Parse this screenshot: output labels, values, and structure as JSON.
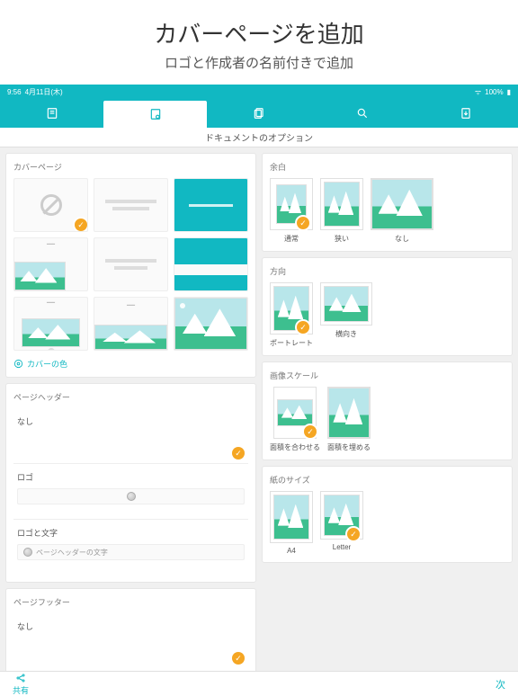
{
  "promo": {
    "title": "カバーページを追加",
    "subtitle": "ロゴと作成者の名前付きで追加"
  },
  "status": {
    "time": "9:56",
    "date": "4月11日(木)",
    "battery": "100%"
  },
  "subbar": {
    "title": "ドキュメントのオプション"
  },
  "cover": {
    "title": "カバーページ",
    "color_link": "カバーの色"
  },
  "header": {
    "title": "ページヘッダー",
    "none": "なし",
    "logo": "ロゴ",
    "logo_text": "ロゴと文字",
    "placeholder": "ページヘッダーの文字"
  },
  "footer": {
    "title": "ページフッター",
    "none": "なし"
  },
  "margin": {
    "title": "余白",
    "normal": "通常",
    "narrow": "狭い",
    "none": "なし"
  },
  "orient": {
    "title": "方向",
    "portrait": "ポートレート",
    "landscape": "横向き"
  },
  "scale": {
    "title": "画像スケール",
    "fit": "面積を合わせる",
    "fill": "面積を埋める"
  },
  "paper": {
    "title": "紙のサイズ",
    "a4": "A4",
    "letter": "Letter"
  },
  "bottom": {
    "share": "共有",
    "next": "次"
  }
}
